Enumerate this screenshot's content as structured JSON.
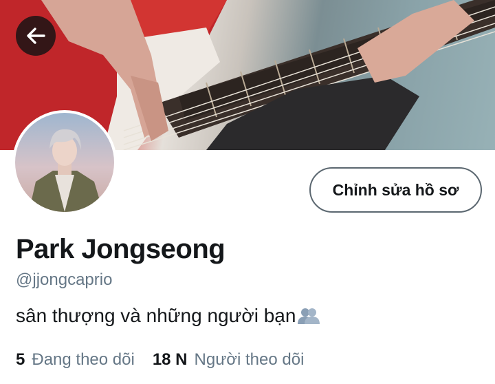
{
  "profile": {
    "name": "Park Jongseong",
    "handle": "@jjongcaprio",
    "bio": "sân thượng và những người bạn",
    "bio_emoji": "busts-in-silhouette-icon",
    "edit_button_label": "Chỉnh sửa hồ sơ"
  },
  "stats": {
    "following_count": "5",
    "following_label": "Đang theo dõi",
    "followers_count": "18 N",
    "followers_label": "Người theo dõi"
  },
  "icons": {
    "back": "arrow-left-icon"
  },
  "colors": {
    "text_primary": "#14171a",
    "text_secondary": "#657786",
    "button_border": "#5b6770",
    "back_button_bg": "#141414"
  }
}
